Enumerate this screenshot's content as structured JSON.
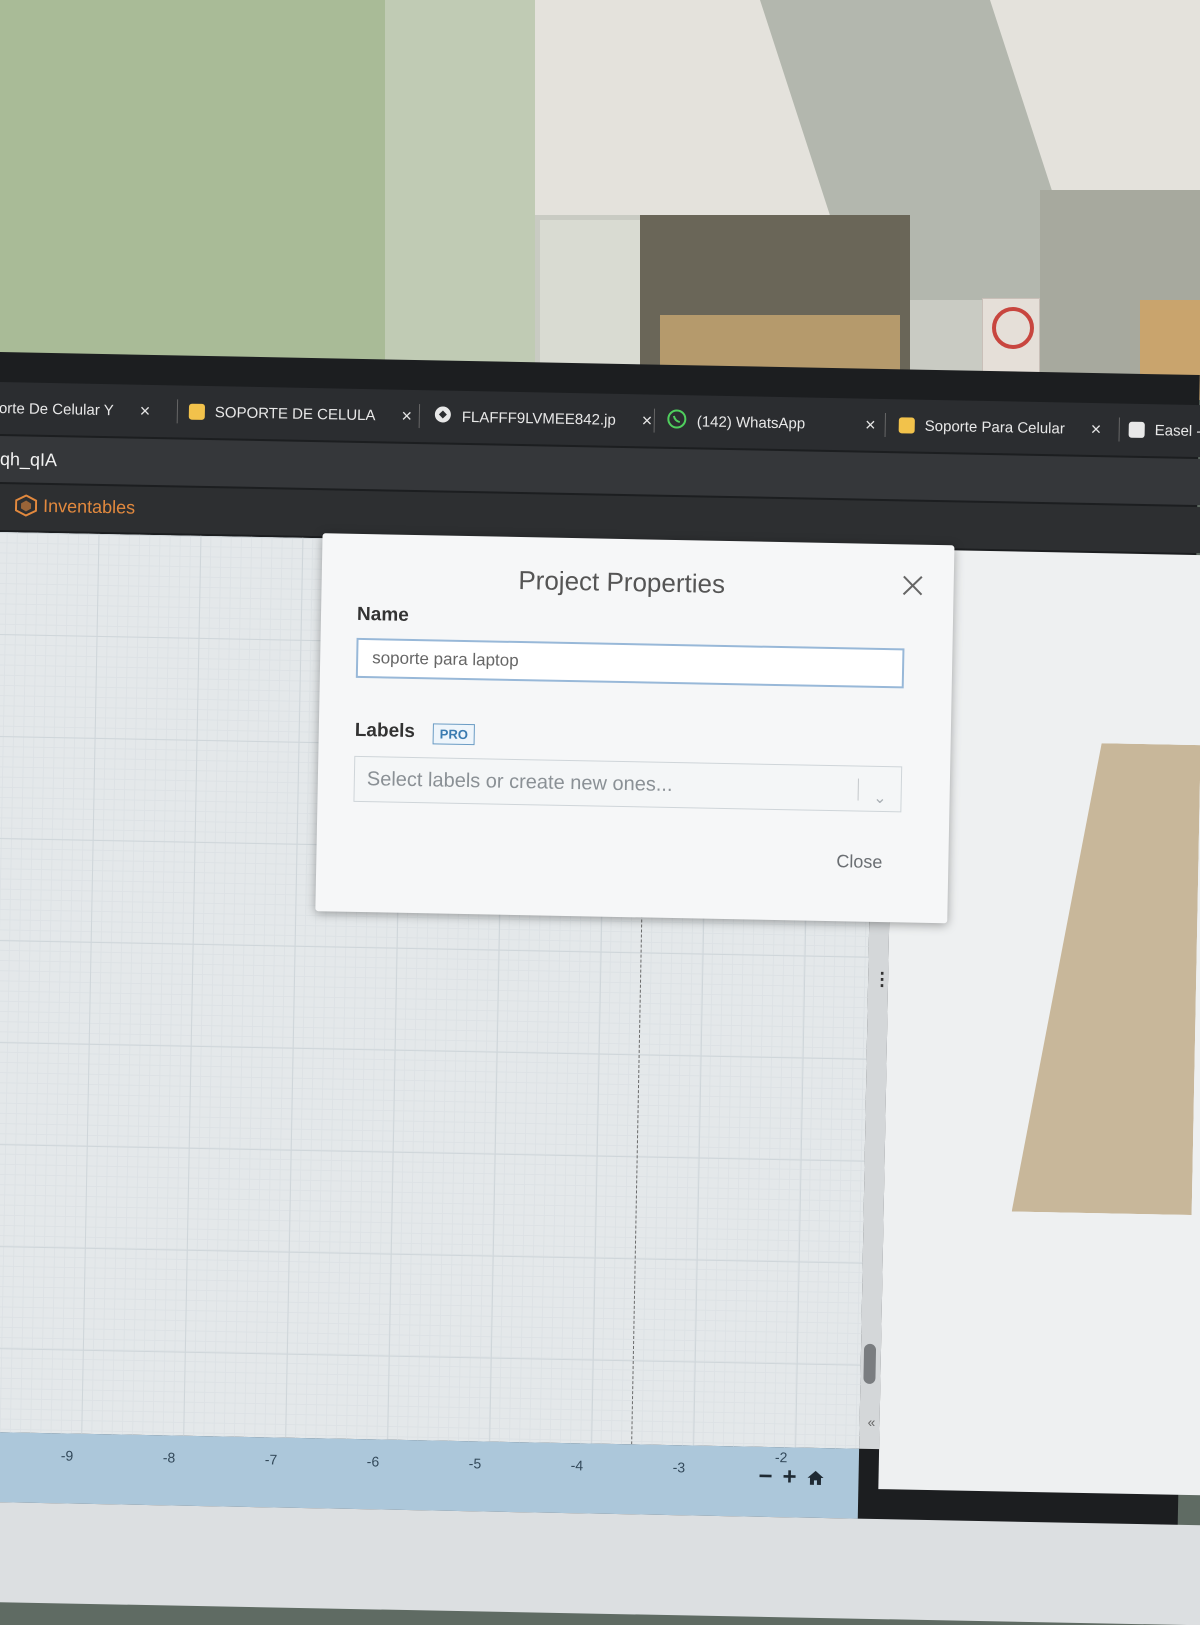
{
  "browser": {
    "tabs": [
      {
        "label": "orte De Celular Y",
        "icon": "page-icon"
      },
      {
        "label": "SOPORTE DE CELULA",
        "icon": "easel-app-icon"
      },
      {
        "label": "FLAFFF9LVMEE842.jp",
        "icon": "globe-icon"
      },
      {
        "label": "(142) WhatsApp",
        "icon": "whatsapp-icon"
      },
      {
        "label": "Soporte Para Celular",
        "icon": "easel-app-icon"
      },
      {
        "label": "Easel -",
        "icon": "page-icon"
      }
    ],
    "tab_close_glyph": "×",
    "address_fragment": "qh_qIA"
  },
  "app": {
    "brand": "Inventables"
  },
  "dialog": {
    "title": "Project Properties",
    "name_label": "Name",
    "name_value": "soporte para laptop",
    "labels_label": "Labels",
    "pro_badge": "PRO",
    "labels_placeholder": "Select labels or create new ones...",
    "close_label": "Close"
  },
  "ruler": {
    "ticks": [
      "-9",
      "-8",
      "-7",
      "-6",
      "-5",
      "-4",
      "-3",
      "-2"
    ]
  },
  "zoom": {
    "minus": "−",
    "plus": "+"
  },
  "colors": {
    "brand_orange": "#e2893e",
    "pro_blue": "#3b7bb0",
    "ruler_bg": "#acc7da"
  }
}
